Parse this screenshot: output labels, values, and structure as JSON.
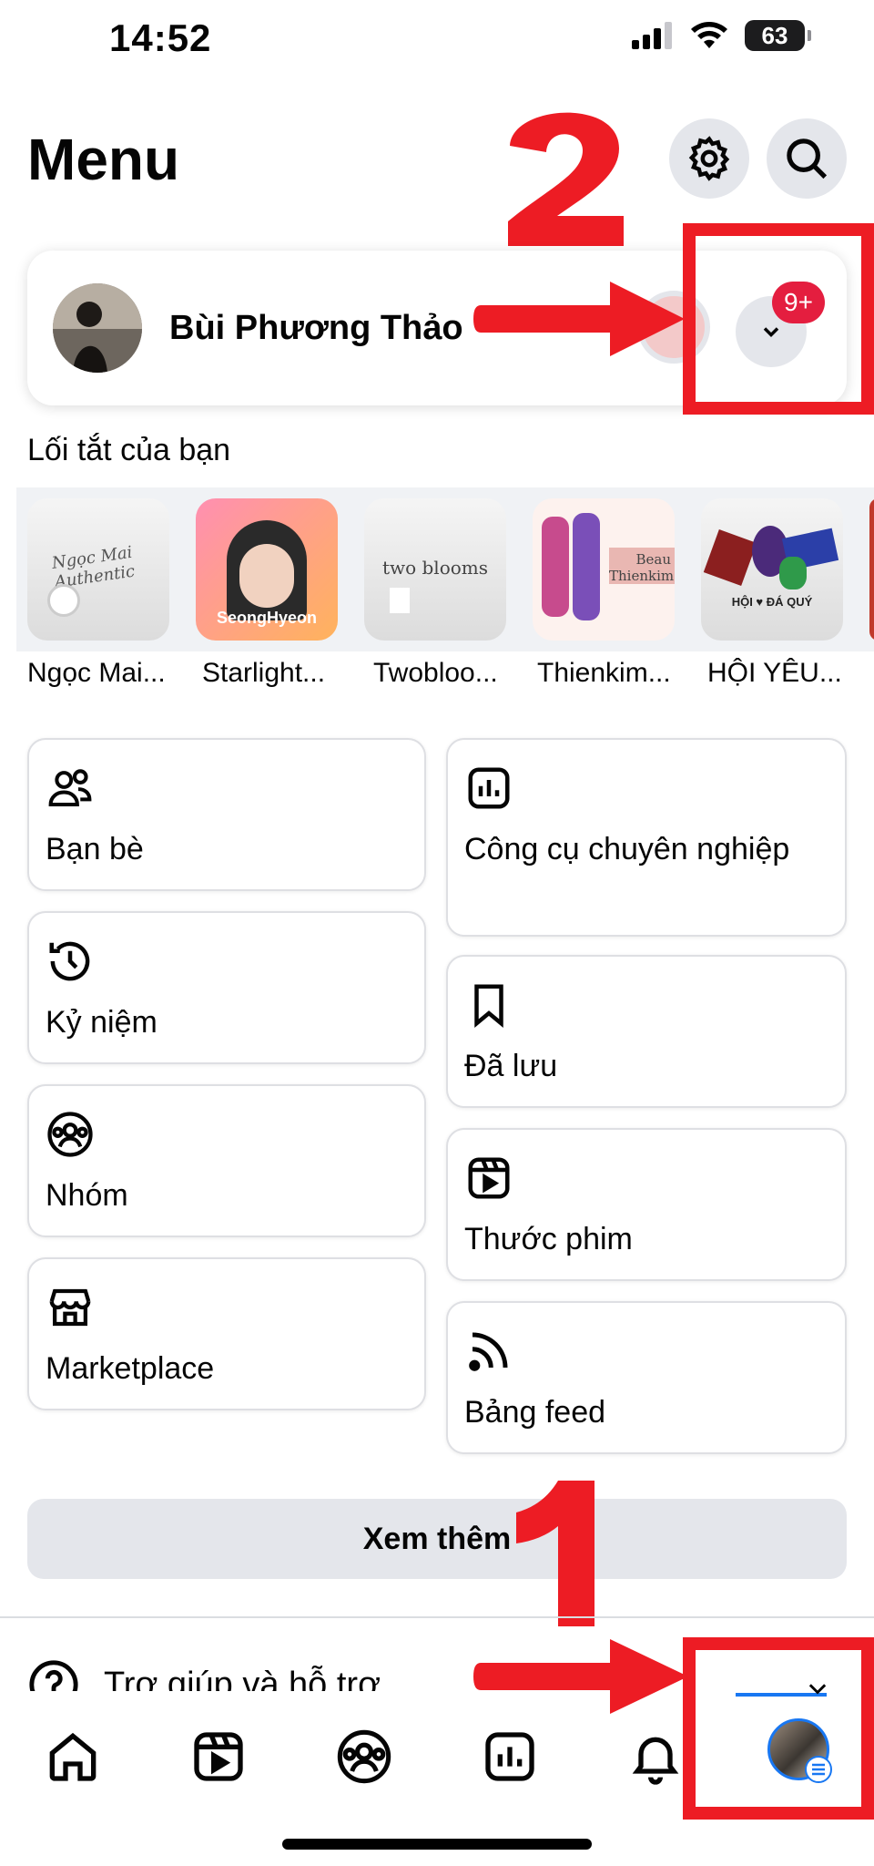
{
  "status": {
    "time": "14:52",
    "battery": "63"
  },
  "header": {
    "title": "Menu",
    "settings_icon": "gear-icon",
    "search_icon": "search-icon"
  },
  "profile": {
    "name": "Bùi Phương Thảo",
    "notification_badge": "9+"
  },
  "shortcuts": {
    "title": "Lối tắt của bạn",
    "items": [
      {
        "label": "Ngọc Mai...",
        "art": "Ngọc Mai Authentic"
      },
      {
        "label": "Starlight...",
        "art": "SeongHyeon"
      },
      {
        "label": "Twobloo...",
        "art": "two blooms"
      },
      {
        "label": "Thienkim...",
        "art": "Beau Thienkim"
      },
      {
        "label": "HỘI YÊU...",
        "art": "HỘI ♥ ĐÁ QUÝ"
      }
    ]
  },
  "menu": {
    "left": [
      {
        "label": "Bạn bè",
        "icon": "friends-icon"
      },
      {
        "label": "Kỷ niệm",
        "icon": "memories-clock-icon"
      },
      {
        "label": "Nhóm",
        "icon": "groups-icon"
      },
      {
        "label": "Marketplace",
        "icon": "marketplace-store-icon"
      }
    ],
    "right": [
      {
        "label": "Công cụ chuyên nghiệp",
        "icon": "professional-tools-chart-icon"
      },
      {
        "label": "Đã lưu",
        "icon": "bookmark-icon"
      },
      {
        "label": "Thước phim",
        "icon": "reels-icon"
      },
      {
        "label": "Bảng feed",
        "icon": "feed-rss-icon"
      }
    ]
  },
  "see_more": "Xem thêm",
  "help": {
    "label": "Trợ giúp và hỗ trợ",
    "icon": "question-icon"
  },
  "tabbar": [
    "home-icon",
    "video-icon",
    "groups-icon",
    "dashboard-icon",
    "bell-icon",
    "profile-menu-icon"
  ],
  "annotations": {
    "step1": "1",
    "step2": "2",
    "color": "#ed1c24"
  },
  "colors": {
    "accent": "#1877f2",
    "badge": "#e41e3f",
    "tile_border": "#dedfe3"
  }
}
